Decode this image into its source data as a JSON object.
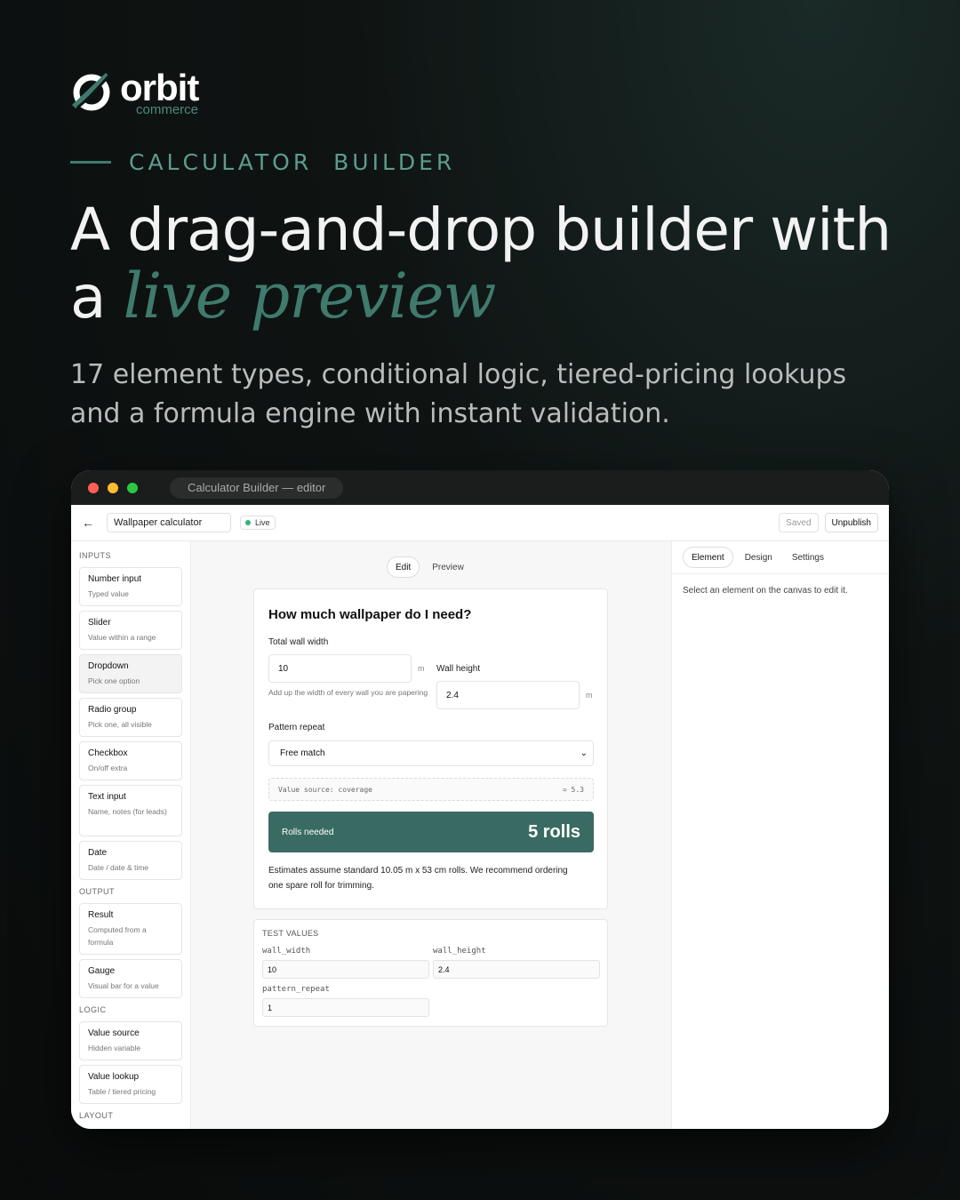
{
  "brand": {
    "name": "orbit",
    "tagline": "commerce",
    "accent": "#3f7a6d"
  },
  "hero": {
    "eyebrow": "CALCULATOR  BUILDER",
    "headline_line1": "A drag-and-drop builder with",
    "headline_line2_prefix": "a ",
    "headline_line2_emphasis": "live preview",
    "subtitle": "17 element types, conditional logic, tiered-pricing lookups and a formula engine with instant validation."
  },
  "window": {
    "title": "Calculator Builder — editor",
    "dots": [
      "#ff5f57",
      "#febc2e",
      "#28c840"
    ]
  },
  "topbar": {
    "back_icon": "arrow-left-icon",
    "calculator_name": "Wallpaper calculator",
    "status_label": "Live",
    "saved_label": "Saved",
    "unpublish_label": "Unpublish"
  },
  "sidebar": {
    "sections": [
      {
        "title": "INPUTS",
        "items": [
          {
            "title": "Number input",
            "desc": "Typed value"
          },
          {
            "title": "Slider",
            "desc": "Value within a range"
          },
          {
            "title": "Dropdown",
            "desc": "Pick one option"
          },
          {
            "title": "Radio group",
            "desc": "Pick one, all visible"
          },
          {
            "title": "Checkbox",
            "desc": "On/off extra"
          },
          {
            "title": "Text input",
            "desc": "Name, notes (for leads)"
          },
          {
            "title": "Date",
            "desc": "Date / date & time"
          }
        ]
      },
      {
        "title": "OUTPUT",
        "items": [
          {
            "title": "Result",
            "desc": "Computed from a formula"
          },
          {
            "title": "Gauge",
            "desc": "Visual bar for a value"
          }
        ]
      },
      {
        "title": "LOGIC",
        "items": [
          {
            "title": "Value source",
            "desc": "Hidden variable"
          },
          {
            "title": "Value lookup",
            "desc": "Table / tiered pricing"
          }
        ]
      },
      {
        "title": "LAYOUT",
        "items": []
      }
    ]
  },
  "canvas": {
    "tabs": [
      "Edit",
      "Preview"
    ],
    "active_tab": "Edit",
    "form": {
      "title": "How much wallpaper do I need?",
      "wall_width_label": "Total wall width",
      "wall_width_value": "10",
      "wall_width_unit": "m",
      "wall_width_hint": "Add up the width of every wall you are papering",
      "wall_height_label": "Wall height",
      "wall_height_value": "2.4",
      "wall_height_unit": "m",
      "pattern_label": "Pattern repeat",
      "pattern_value": "Free match",
      "value_source_label": "Value source: coverage",
      "value_source_value": "= 5.3",
      "result_label": "Rolls needed",
      "result_value": "5 rolls",
      "note": "Estimates assume standard 10.05 m x 53 cm rolls. We recommend ordering one spare roll for trimming."
    },
    "test_values": {
      "title": "TEST VALUES",
      "fields": [
        {
          "key": "wall_width",
          "value": "10"
        },
        {
          "key": "wall_height",
          "value": "2.4"
        },
        {
          "key": "pattern_repeat",
          "value": "1"
        }
      ]
    }
  },
  "inspector": {
    "tabs": [
      "Element",
      "Design",
      "Settings"
    ],
    "active_tab": "Element",
    "empty_message": "Select an element on the canvas to edit it."
  }
}
